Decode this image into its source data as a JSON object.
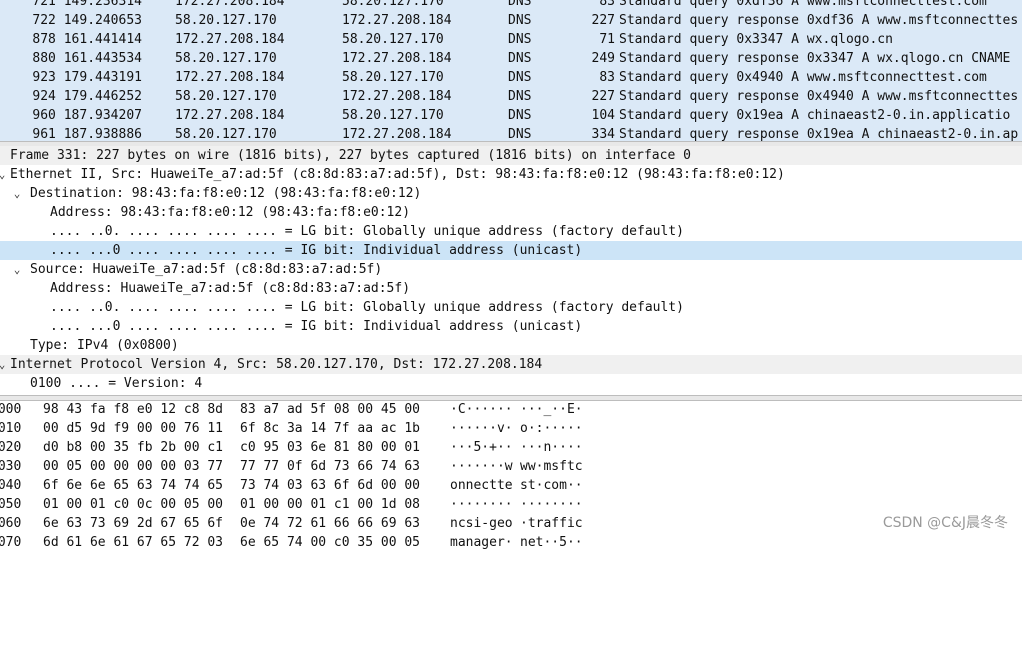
{
  "packets": [
    {
      "no": "721",
      "time": "149.236314",
      "src": "172.27.208.184",
      "dst": "58.20.127.170",
      "proto": "DNS",
      "len": "83",
      "info": "Standard query 0xdf36 A www.msftconnecttest.com"
    },
    {
      "no": "722",
      "time": "149.240653",
      "src": "58.20.127.170",
      "dst": "172.27.208.184",
      "proto": "DNS",
      "len": "227",
      "info": "Standard query response 0xdf36 A www.msftconnecttes"
    },
    {
      "no": "878",
      "time": "161.441414",
      "src": "172.27.208.184",
      "dst": "58.20.127.170",
      "proto": "DNS",
      "len": "71",
      "info": "Standard query 0x3347 A wx.qlogo.cn"
    },
    {
      "no": "880",
      "time": "161.443534",
      "src": "58.20.127.170",
      "dst": "172.27.208.184",
      "proto": "DNS",
      "len": "249",
      "info": "Standard query response 0x3347 A wx.qlogo.cn CNAME"
    },
    {
      "no": "923",
      "time": "179.443191",
      "src": "172.27.208.184",
      "dst": "58.20.127.170",
      "proto": "DNS",
      "len": "83",
      "info": "Standard query 0x4940 A www.msftconnecttest.com"
    },
    {
      "no": "924",
      "time": "179.446252",
      "src": "58.20.127.170",
      "dst": "172.27.208.184",
      "proto": "DNS",
      "len": "227",
      "info": "Standard query response 0x4940 A www.msftconnecttes"
    },
    {
      "no": "960",
      "time": "187.934207",
      "src": "172.27.208.184",
      "dst": "58.20.127.170",
      "proto": "DNS",
      "len": "104",
      "info": "Standard query 0x19ea A chinaeast2-0.in.applicatio"
    },
    {
      "no": "961",
      "time": "187.938886",
      "src": "58.20.127.170",
      "dst": "172.27.208.184",
      "proto": "DNS",
      "len": "334",
      "info": "Standard query response 0x19ea A chinaeast2-0.in.ap"
    }
  ],
  "details": {
    "frame": "Frame 331: 227 bytes on wire (1816 bits), 227 bytes captured (1816 bits) on interface 0",
    "ethernet": "Ethernet II, Src: HuaweiTe_a7:ad:5f (c8:8d:83:a7:ad:5f), Dst: 98:43:fa:f8:e0:12 (98:43:fa:f8:e0:12)",
    "destination": "Destination: 98:43:fa:f8:e0:12 (98:43:fa:f8:e0:12)",
    "dst_address": "Address: 98:43:fa:f8:e0:12 (98:43:fa:f8:e0:12)",
    "dst_lg": ".... ..0. .... .... .... .... = LG bit: Globally unique address (factory default)",
    "dst_ig": ".... ...0 .... .... .... .... = IG bit: Individual address (unicast)",
    "source": "Source: HuaweiTe_a7:ad:5f (c8:8d:83:a7:ad:5f)",
    "src_address": "Address: HuaweiTe_a7:ad:5f (c8:8d:83:a7:ad:5f)",
    "src_lg": ".... ..0. .... .... .... .... = LG bit: Globally unique address (factory default)",
    "src_ig": ".... ...0 .... .... .... .... = IG bit: Individual address (unicast)",
    "type": "Type: IPv4 (0x0800)",
    "ip": "Internet Protocol Version 4, Src: 58.20.127.170, Dst: 172.27.208.184",
    "version": "0100 .... = Version: 4"
  },
  "bytes": [
    {
      "off": "0000",
      "hex1": "98 43 fa f8 e0 12 c8 8d",
      "hex2": "83 a7 ad 5f 08 00 45 00",
      "asc1": "·C······",
      "asc2": "···_··E·"
    },
    {
      "off": "0010",
      "hex1": "00 d5 9d f9 00 00 76 11",
      "hex2": "6f 8c 3a 14 7f aa ac 1b",
      "asc1": "······v·",
      "asc2": "o·:·····"
    },
    {
      "off": "0020",
      "hex1": "d0 b8 00 35 fb 2b 00 c1",
      "hex2": "c0 95 03 6e 81 80 00 01",
      "asc1": "···5·+··",
      "asc2": "···n····"
    },
    {
      "off": "0030",
      "hex1": "00 05 00 00 00 00 03 77",
      "hex2": "77 77 0f 6d 73 66 74 63",
      "asc1": "·······w",
      "asc2": "ww·msftc"
    },
    {
      "off": "0040",
      "hex1": "6f 6e 6e 65 63 74 74 65",
      "hex2": "73 74 03 63 6f 6d 00 00",
      "asc1": "onnectte",
      "asc2": "st·com··"
    },
    {
      "off": "0050",
      "hex1": "01 00 01 c0 0c 00 05 00",
      "hex2": "01 00 00 01 c1 00 1d 08",
      "asc1": "········",
      "asc2": "········"
    },
    {
      "off": "0060",
      "hex1": "6e 63 73 69 2d 67 65 6f",
      "hex2": "0e 74 72 61 66 66 69 63",
      "asc1": "ncsi-geo",
      "asc2": "·traffic"
    },
    {
      "off": "0070",
      "hex1": "6d 61 6e 61 67 65 72 03",
      "hex2": "6e 65 74 00 c0 35 00 05",
      "asc1": "manager·",
      "asc2": "net··5··"
    }
  ],
  "watermark": "CSDN @C&J晨冬冬",
  "colors": {
    "packet_bg": "#dbe9f7",
    "selected_bg": "#cce4f7",
    "band_bg": "#f0f0f0"
  }
}
